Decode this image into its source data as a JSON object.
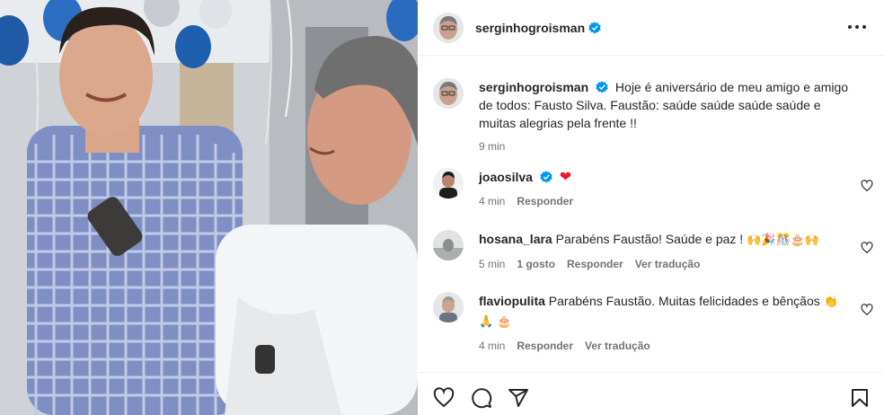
{
  "post": {
    "author": "serginhogroisman",
    "more_icon": "more-horizontal-icon"
  },
  "caption": {
    "user": "serginhogroisman",
    "text": "Hoje é aniversário de meu amigo e amigo de todos: Fausto Silva. Faustão: saúde saúde saúde saúde e muitas alegrias pela frente !!",
    "time": "9 min"
  },
  "comments": [
    {
      "user": "joaosilva",
      "text": "",
      "emoji": "❤",
      "time": "4 min",
      "likes": "",
      "reply": "Responder",
      "translate": ""
    },
    {
      "user": "hosana_lara",
      "text": "Parabéns Faustão! Saúde e paz !",
      "emoji": "🙌🎉🎊🎂🙌",
      "time": "5 min",
      "likes": "1 gosto",
      "reply": "Responder",
      "translate": "Ver tradução"
    },
    {
      "user": "flaviopulita",
      "text": "Parabéns Faustão. Muitas felicidades e bênçãos",
      "emoji": "👏",
      "emoji2": "🙏 🎂",
      "time": "4 min",
      "likes": "",
      "reply": "Responder",
      "translate": "Ver tradução"
    }
  ],
  "colors": {
    "verified_blue": "#0095f6",
    "like_red": "#ed1a2f",
    "text": "#262626",
    "muted": "#737373"
  },
  "icons": [
    "like-heart-icon",
    "comment-icon",
    "share-icon",
    "save-bookmark-icon"
  ]
}
